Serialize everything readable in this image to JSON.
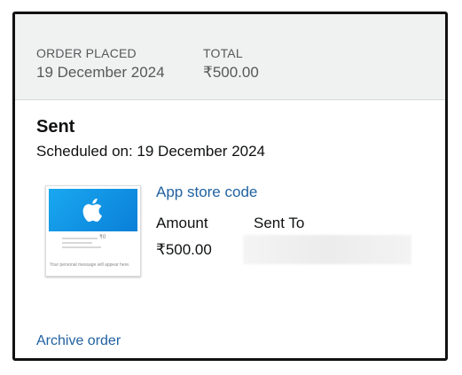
{
  "order_header": {
    "placed_label": "ORDER PLACED",
    "placed_value": "19 December 2024",
    "total_label": "TOTAL",
    "total_value": "₹500.00"
  },
  "shipment": {
    "status": "Sent",
    "scheduled": "Scheduled on: 19 December 2024"
  },
  "item": {
    "title": "App store code",
    "amount_label": "Amount",
    "sent_to_label": "Sent To",
    "amount_value": "₹500.00",
    "thumbnail": {
      "icon": "apple-logo-icon",
      "mini_amount": "₹0",
      "mini_message": "Your personal message will appear here."
    }
  },
  "actions": {
    "archive_label": "Archive order"
  },
  "colors": {
    "header_bg": "#f0f2f2",
    "link": "#2162a1",
    "card_blue": "#0a7fd8"
  }
}
